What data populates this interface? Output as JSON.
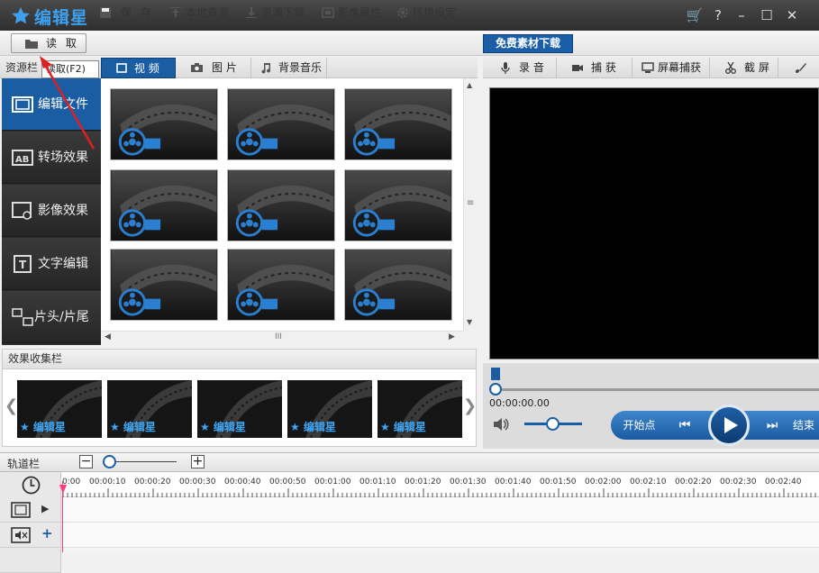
{
  "app": {
    "title": "编辑星"
  },
  "toolbar": {
    "open": "读 取",
    "save": "保 存",
    "local": "本地资源",
    "download": "资源下载",
    "props": "影像属性",
    "settings": "环境设定",
    "free": "免费素材下载"
  },
  "tooltip": "读取(F2)",
  "resource": {
    "label": "资源栏",
    "tabs": [
      "视 频",
      "图 片",
      "背景音乐"
    ]
  },
  "sidebar": {
    "items": [
      "编辑文件",
      "转场效果",
      "影像效果",
      "文字编辑",
      "片头/片尾"
    ]
  },
  "favorites": {
    "label": "效果收集栏",
    "brand": "编辑星",
    "count": 5
  },
  "right_tools": [
    "录 音",
    "捕 获",
    "屏幕捕获",
    "截 屏"
  ],
  "player": {
    "time": "00:00:00.00",
    "start": "开始点",
    "end": "结束"
  },
  "timeline": {
    "label": "轨道栏",
    "ticks": [
      "0:00",
      "00:00:10",
      "00:00:20",
      "00:00:30",
      "00:00:40",
      "00:00:50",
      "00:01:00",
      "00:01:10",
      "00:01:20",
      "00:01:30",
      "00:01:40",
      "00:01:50",
      "00:02:00",
      "00:02:10",
      "00:02:20",
      "00:02:30",
      "00:02:40"
    ]
  },
  "colors": {
    "accent": "#1a5da3",
    "playhead": "#ff3a7a",
    "arrow": "#e02020"
  }
}
